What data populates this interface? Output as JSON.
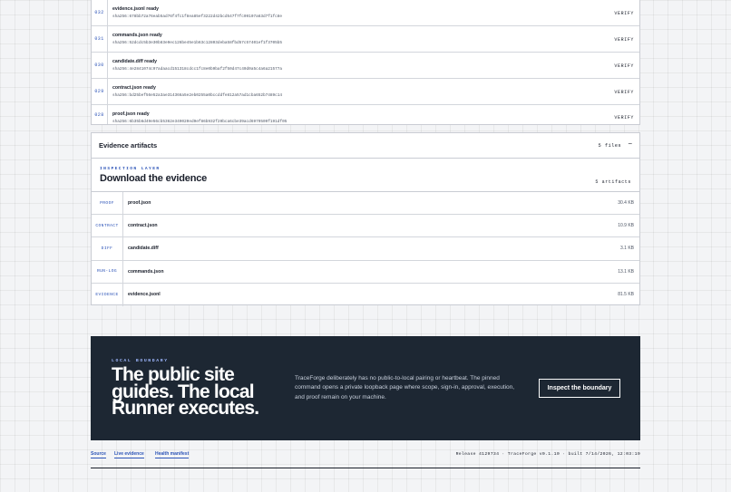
{
  "events": [
    {
      "num": "032",
      "title": "evidence.jsonl ready",
      "hash": "sha256:678bb72a76eab5ad76f4fc1f8ea85ef3222d42bcd547f7fc09107a63d7f1fc8e",
      "action": "VERIFY"
    },
    {
      "num": "031",
      "title": "commands.json ready",
      "hash": "sha256:52dcdc5b3e30b83e9ec126be45e1b63c12803deba58fbd57c57401ef1f3705b5",
      "action": "VERIFY"
    },
    {
      "num": "030",
      "title": "candidate.diff ready",
      "hash": "sha256:4e2841074c97adaacd151318cdcc1fc8e0b9baf2f50d47c40d0a5c4a6a21577a",
      "action": "VERIFY"
    },
    {
      "num": "029",
      "title": "contract.json ready",
      "hash": "sha256:bd25bef56e52a3ae314366a5e2eb0255a0bccddfe812a57ad1cba652b7489c14",
      "action": "VERIFY"
    },
    {
      "num": "028",
      "title": "proof.json ready",
      "hash": "sha256:6b35b6d49e56cb5362e349020ed9ef86b932f20bca6cbe39acd6979509f191df05",
      "action": "VERIFY"
    }
  ],
  "artifacts_panel": {
    "title": "Evidence artifacts",
    "files_count": "5 files",
    "toggle": "−"
  },
  "inspection": {
    "kicker": "INSPECTION LAYER",
    "title": "Download the evidence",
    "count": "5 artifacts"
  },
  "artifacts": [
    {
      "kind": "PROOF",
      "name": "proof.json",
      "size": "30.4 KB"
    },
    {
      "kind": "CONTRACT",
      "name": "contract.json",
      "size": "10.9 KB"
    },
    {
      "kind": "DIFF",
      "name": "candidate.diff",
      "size": "3.1 KB"
    },
    {
      "kind": "RUN-LOG",
      "name": "commands.json",
      "size": "13.1 KB"
    },
    {
      "kind": "EVIDENCE",
      "name": "evidence.jsonl",
      "size": "81.5 KB"
    }
  ],
  "boundary": {
    "kicker": "LOCAL BOUNDARY",
    "title_lines": [
      "The public site",
      "guides. The local",
      "Runner executes."
    ],
    "text": "TraceForge deliberately has no public-to-local pairing or heartbeat. The pinned command opens a private loopback page where scope, sign-in, approval, execution, and proof remain on your machine.",
    "button": "Inspect the boundary"
  },
  "footer": {
    "links": [
      "Source",
      "Live evidence",
      "Health manifest"
    ],
    "release": "Release 4129734 · TraceForge v0.1.10 · built 7/14/2026, 12:03:19"
  },
  "colors": {
    "accent": "#2e55b8",
    "dark": "#1d2733"
  }
}
